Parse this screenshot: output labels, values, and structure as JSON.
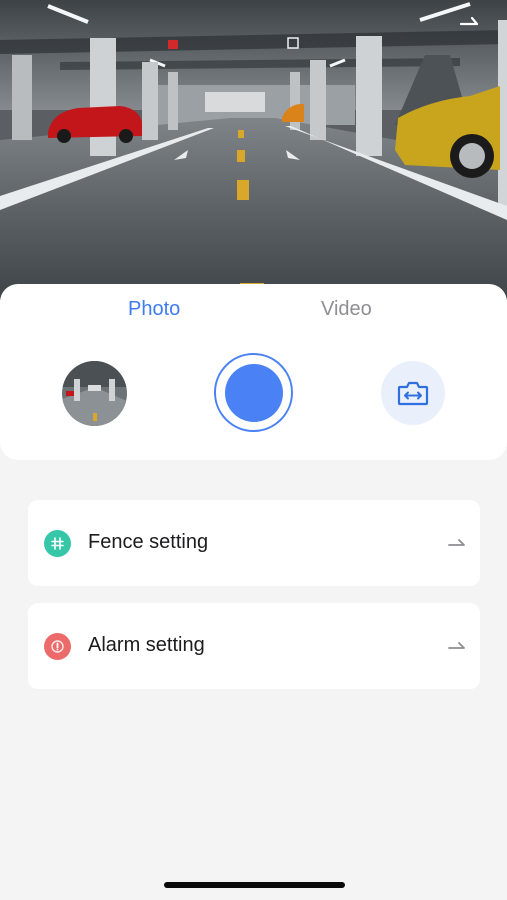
{
  "preview": {
    "fullscreen_icon": "fullscreen-arrow-icon"
  },
  "capture": {
    "tabs": [
      {
        "label": "Photo",
        "active": true
      },
      {
        "label": "Video",
        "active": false
      }
    ],
    "accent_color": "#3f7cf2",
    "inactive_color": "#8e8e93",
    "thumbnail_icon": "last-capture-thumbnail",
    "shutter_icon": "shutter-icon",
    "switch_icon": "switch-camera-icon"
  },
  "settings": {
    "items": [
      {
        "label": "Fence setting",
        "icon": "fence-grid-icon",
        "icon_color": "#35c7a8"
      },
      {
        "label": "Alarm setting",
        "icon": "alarm-icon",
        "icon_color": "#ec6a6a"
      }
    ]
  }
}
